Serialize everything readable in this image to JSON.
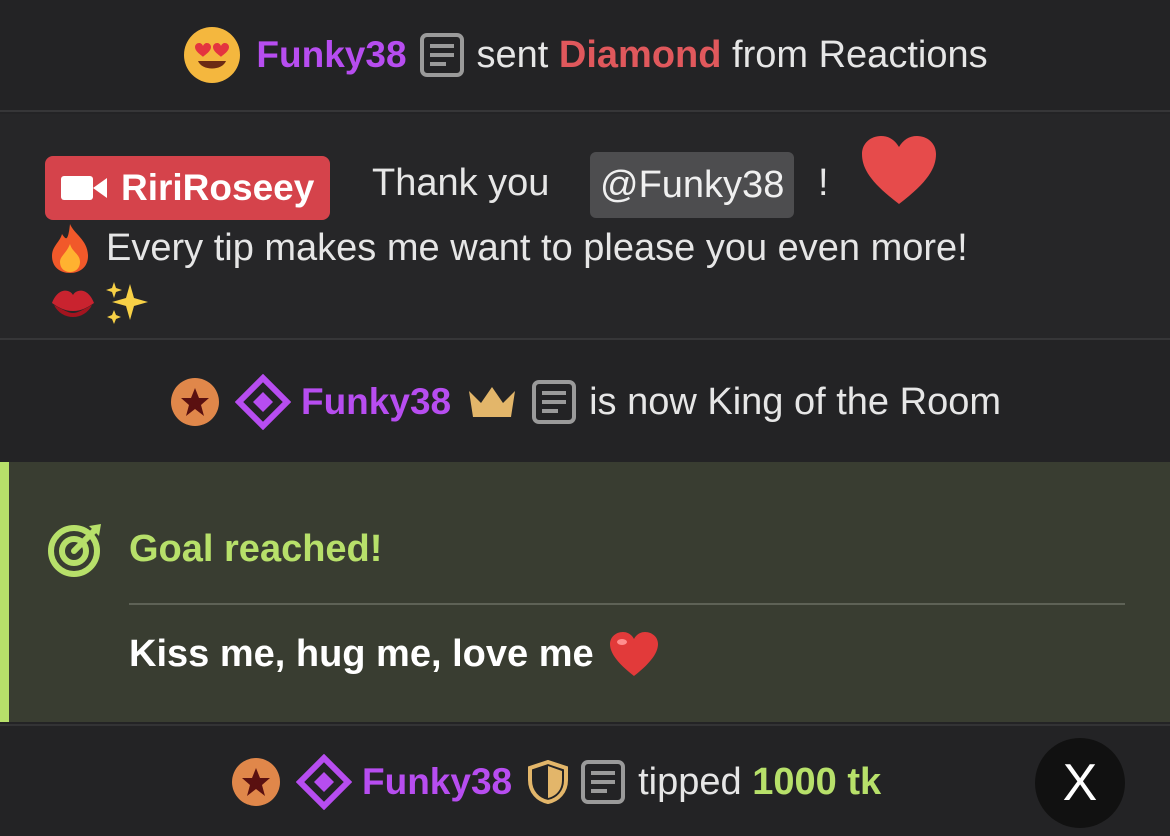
{
  "row1": {
    "emoji_icon": "heart-eyes-emoji",
    "user": "Funky38",
    "note_icon": "note-icon",
    "text_before": "sent",
    "gift": "Diamond",
    "text_after": "from Reactions"
  },
  "row2": {
    "streamer_icon": "video-camera-icon",
    "streamer": "RiriRoseey",
    "thanks": "Thank you",
    "mention": "@Funky38",
    "exclaim": "!",
    "line2_icon": "fire-emoji",
    "line2": "Every tip makes me want to please you even more!",
    "line3_icons": [
      "kiss-mark-emoji",
      "sparkles-emoji"
    ],
    "heart_icon": "red-heart-icon"
  },
  "row3": {
    "user": "Funky38",
    "icons": [
      "star-badge-icon",
      "diamond-icon",
      "crown-icon",
      "note-icon"
    ],
    "text": "is now King of the Room"
  },
  "goal": {
    "icon": "target-icon",
    "title": "Goal reached!",
    "text": "Kiss me, hug me, love me",
    "emoji": "red-heart-emoji"
  },
  "row5": {
    "user": "Funky38",
    "icons": [
      "star-badge-icon",
      "diamond-icon",
      "shield-icon",
      "note-icon"
    ],
    "text": "tipped",
    "amount": "1000 tk",
    "close_glyph": "X",
    "close_icon": "x-icon"
  },
  "colors": {
    "background": "#232325",
    "username": "#b74df0",
    "gift": "#e0585c",
    "accent_green": "#b7e06a",
    "streamer_badge": "#d5434b",
    "goal_background": "#393d31"
  }
}
